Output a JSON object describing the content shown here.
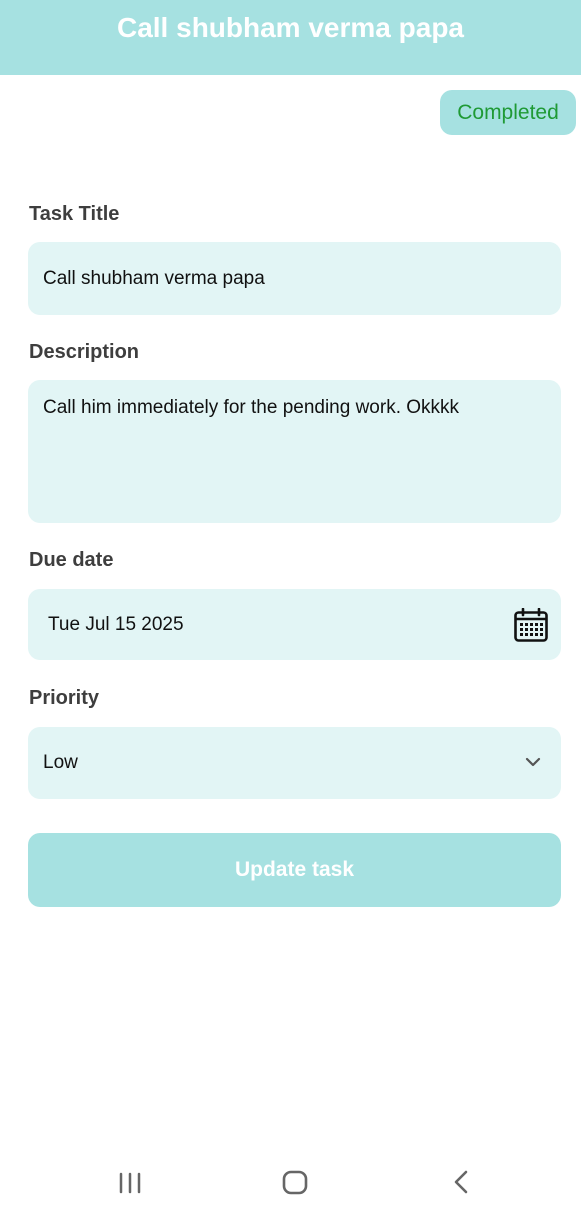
{
  "header": {
    "title": "Call shubham verma papa"
  },
  "status": {
    "label": "Completed"
  },
  "form": {
    "title_label": "Task Title",
    "title_value": "Call shubham verma papa",
    "description_label": "Description",
    "description_value": "Call him immediately for the pending work. Okkkk",
    "due_date_label": "Due date",
    "due_date_value": "Tue Jul 15 2025",
    "priority_label": "Priority",
    "priority_value": "Low"
  },
  "actions": {
    "update_label": "Update task"
  },
  "navbar": {
    "icons": [
      "recent-apps-icon",
      "home-icon",
      "back-icon"
    ]
  },
  "colors": {
    "accent": "#a6e1e1",
    "field_background": "#e2f5f5",
    "status_text": "#1f9a35",
    "label_text": "#3e3e3e"
  }
}
